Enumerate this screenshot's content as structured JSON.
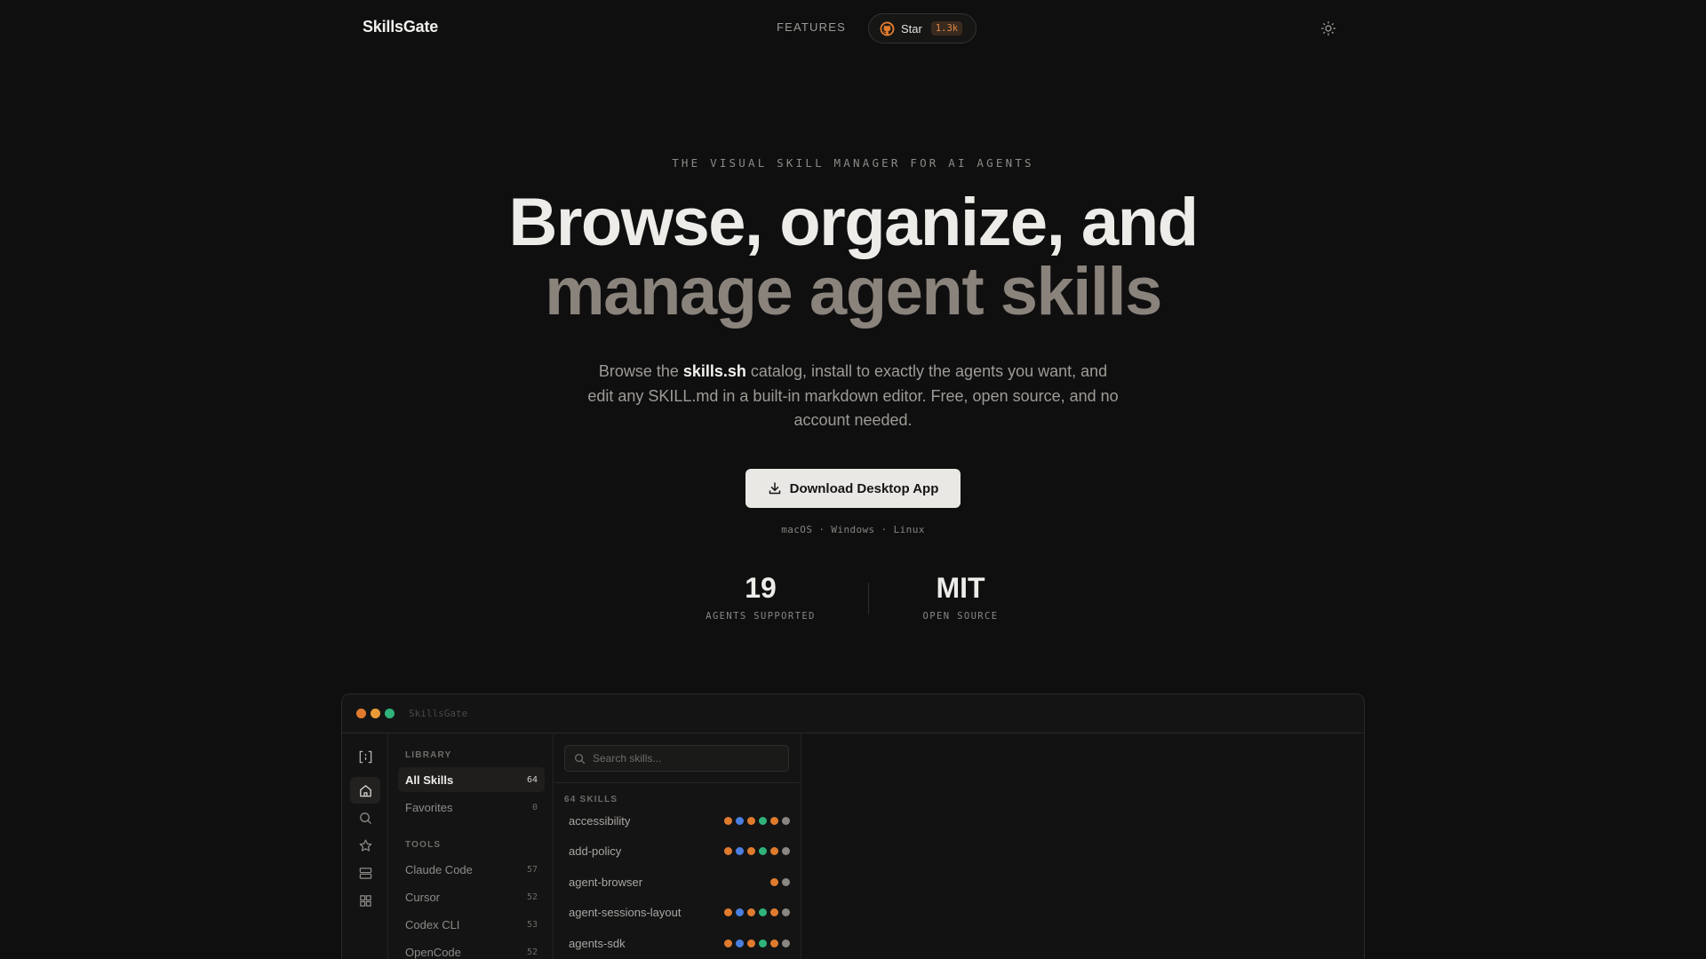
{
  "nav": {
    "logo": "SkillsGate",
    "features": "FEATURES",
    "star_label": "Star",
    "star_count": "1.3k"
  },
  "hero": {
    "eyebrow": "THE VISUAL SKILL MANAGER FOR AI AGENTS",
    "headline_line1": "Browse, organize, and",
    "headline_line2": "manage agent skills",
    "subtitle_pre": "Browse the ",
    "subtitle_link": "skills.sh",
    "subtitle_post": " catalog, install to exactly the agents you want, and edit any SKILL.md in a built-in markdown editor. Free, open source, and no account needed.",
    "download_label": "Download Desktop App",
    "platforms": "macOS · Windows · Linux"
  },
  "stats": [
    {
      "value": "19",
      "label": "AGENTS SUPPORTED"
    },
    {
      "value": "MIT",
      "label": "OPEN SOURCE"
    }
  ],
  "app": {
    "title": "SkillsGate",
    "library_label": "LIBRARY",
    "library_items": [
      {
        "name": "All Skills",
        "count": "64"
      },
      {
        "name": "Favorites",
        "count": "0"
      }
    ],
    "tools_label": "TOOLS",
    "tool_items": [
      {
        "name": "Claude Code",
        "count": "57"
      },
      {
        "name": "Cursor",
        "count": "52"
      },
      {
        "name": "Codex CLI",
        "count": "53"
      },
      {
        "name": "OpenCode",
        "count": "52"
      }
    ],
    "search_placeholder": "Search skills...",
    "skills_count_label": "64 SKILLS",
    "skills": [
      {
        "name": "accessibility",
        "dots": [
          "#e07b2e",
          "#4a7fe0",
          "#e07b2e",
          "#2fb37a",
          "#e07b2e",
          "#8a8783"
        ]
      },
      {
        "name": "add-policy",
        "dots": [
          "#e07b2e",
          "#4a7fe0",
          "#e07b2e",
          "#2fb37a",
          "#e07b2e",
          "#8a8783"
        ]
      },
      {
        "name": "agent-browser",
        "dots": [
          "#e07b2e",
          "#8a8783"
        ]
      },
      {
        "name": "agent-sessions-layout",
        "dots": [
          "#e07b2e",
          "#4a7fe0",
          "#e07b2e",
          "#2fb37a",
          "#e07b2e",
          "#8a8783"
        ]
      },
      {
        "name": "agents-sdk",
        "dots": [
          "#e07b2e",
          "#4a7fe0",
          "#e07b2e",
          "#2fb37a",
          "#e07b2e",
          "#8a8783"
        ]
      }
    ]
  },
  "colors": {
    "background": "#0f0f0f",
    "accent_orange": "#e07b2e",
    "accent_blue": "#4a7fe0",
    "accent_green": "#2fb37a",
    "neutral_dot": "#8a8783"
  }
}
